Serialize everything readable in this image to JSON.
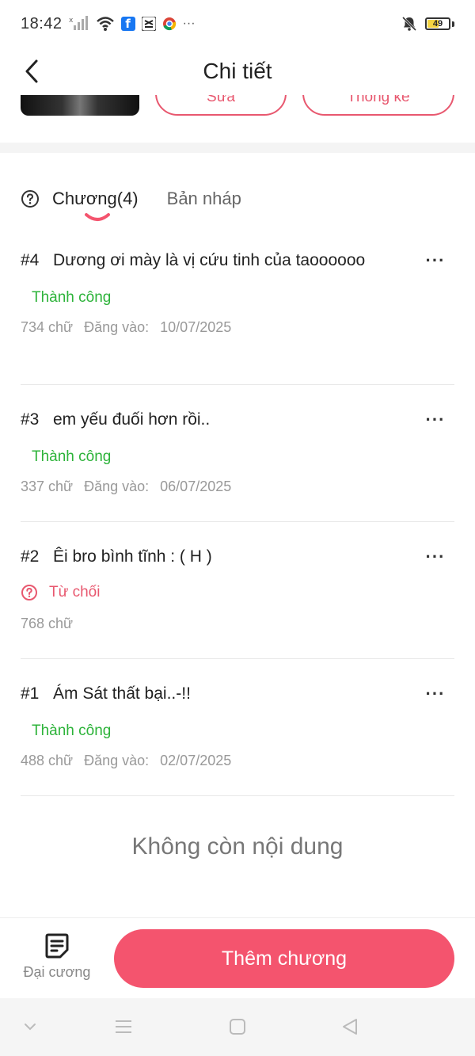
{
  "status_bar": {
    "time": "18:42",
    "battery_level": "49",
    "more_indicator": "···"
  },
  "header": {
    "title": "Chi tiết"
  },
  "top_buttons": {
    "edit_label": "Sửa",
    "stats_label": "Thống kê"
  },
  "tabs": {
    "chapters_label": "Chương(4)",
    "drafts_label": "Bản nháp"
  },
  "chapters": [
    {
      "num": "#4",
      "title": "Dương ơi mày là vị cứu tinh của taoooooo",
      "status": "Thành công",
      "status_type": "success",
      "words": "734 chữ",
      "posted_label": "Đăng vào:",
      "date": "10/07/2025"
    },
    {
      "num": "#3",
      "title": "em yếu đuối hơn rồi..",
      "status": "Thành công",
      "status_type": "success",
      "words": "337 chữ",
      "posted_label": "Đăng vào:",
      "date": "06/07/2025"
    },
    {
      "num": "#2",
      "title": "Êi bro bình tĩnh : ( H )",
      "status": "Từ chối",
      "status_type": "rejected",
      "words": "768 chữ"
    },
    {
      "num": "#1",
      "title": "Ám Sát thất bại..-!!",
      "status": "Thành công",
      "status_type": "success",
      "words": "488 chữ",
      "posted_label": "Đăng vào:",
      "date": "02/07/2025"
    }
  ],
  "empty_message": "Không còn nội dung",
  "bottom_bar": {
    "outline_label": "Đại cương",
    "add_chapter_label": "Thêm chương"
  },
  "colors": {
    "accent": "#f4546e",
    "success": "#2db33a",
    "reject": "#e8586f"
  }
}
